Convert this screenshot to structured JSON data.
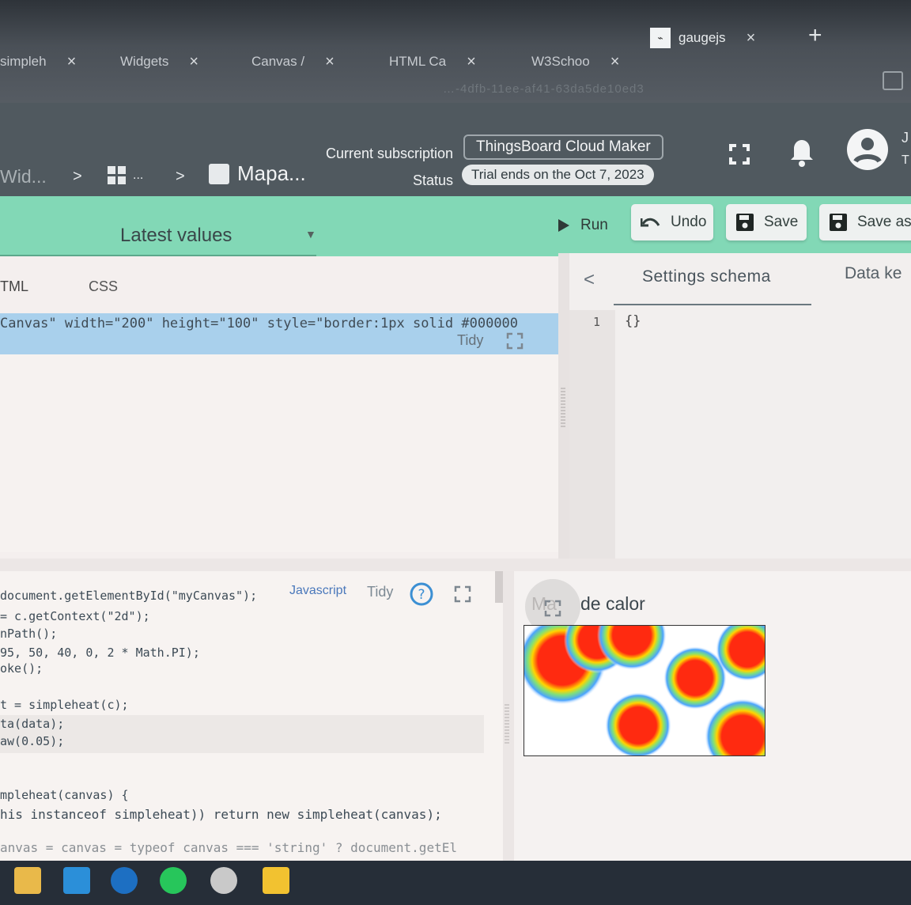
{
  "browser": {
    "tabs": [
      {
        "label": "simpleh",
        "active": false
      },
      {
        "label": "Widgets",
        "active": false
      },
      {
        "label": "Canvas /",
        "active": false
      },
      {
        "label": "HTML Ca",
        "active": false
      },
      {
        "label": "W3Schoo",
        "active": false
      },
      {
        "label": "gaugejs",
        "active": true
      }
    ],
    "close_glyph": "×",
    "new_tab_glyph": "+",
    "url_fragment": "…-4dfb-11ee-af41-63da5de10ed3"
  },
  "header": {
    "breadcrumbs": [
      "Wid...",
      "...",
      "Mapa..."
    ],
    "breadcrumb_separator": ">",
    "subscription_label": "Current subscription",
    "subscription_value": "ThingsBoard Cloud Maker",
    "status_label": "Status",
    "status_value": "Trial ends on the Oct 7, 2023",
    "user_initial_1": "J",
    "user_initial_2": "T",
    "icons": [
      "fullscreen-icon",
      "bell-icon",
      "account-circle-icon"
    ]
  },
  "toolbar": {
    "widget_type": "Latest values",
    "run_label": "Run",
    "undo_label": "Undo",
    "save_label": "Save",
    "save_as_label": "Save as",
    "accent_color": "#82d8b6"
  },
  "html_panel": {
    "tabs": [
      "TML",
      "CSS"
    ],
    "code_line": "Canvas\" width=\"200\" height=\"100\" style=\"border:1px solid #000000",
    "tidy_label": "Tidy"
  },
  "settings_panel": {
    "tabs": [
      "Settings schema",
      "Data ke"
    ],
    "line_number": "1",
    "code": "{}"
  },
  "js_panel": {
    "language_label": "Javascript",
    "tidy_label": "Tidy",
    "help_glyph": "?",
    "lines": [
      "document.getElementById(\"myCanvas\");",
      "= c.getContext(\"2d\");",
      "nPath();",
      "95, 50, 40, 0, 2 * Math.PI);",
      "oke();",
      "",
      "t = simpleheat(c);",
      "ta(data);",
      "aw(0.05);",
      "",
      "",
      "mpleheat(canvas) {",
      "his instanceof simpleheat)) return new simpleheat(canvas);",
      "",
      "anvas = canvas = typeof canvas === 'string' ? document.getEl"
    ]
  },
  "preview": {
    "title_faded": "Ma",
    "title": "de calor",
    "heatmap_colors": [
      "#ff2a10",
      "#ffd400",
      "#7fe07a",
      "#4aa3ff",
      "#ffffff"
    ]
  },
  "taskbar": {
    "icons": [
      "file-explorer-icon",
      "mail-icon",
      "bing-icon",
      "spotify-icon",
      "app-icon",
      "sticky-notes-icon"
    ]
  }
}
